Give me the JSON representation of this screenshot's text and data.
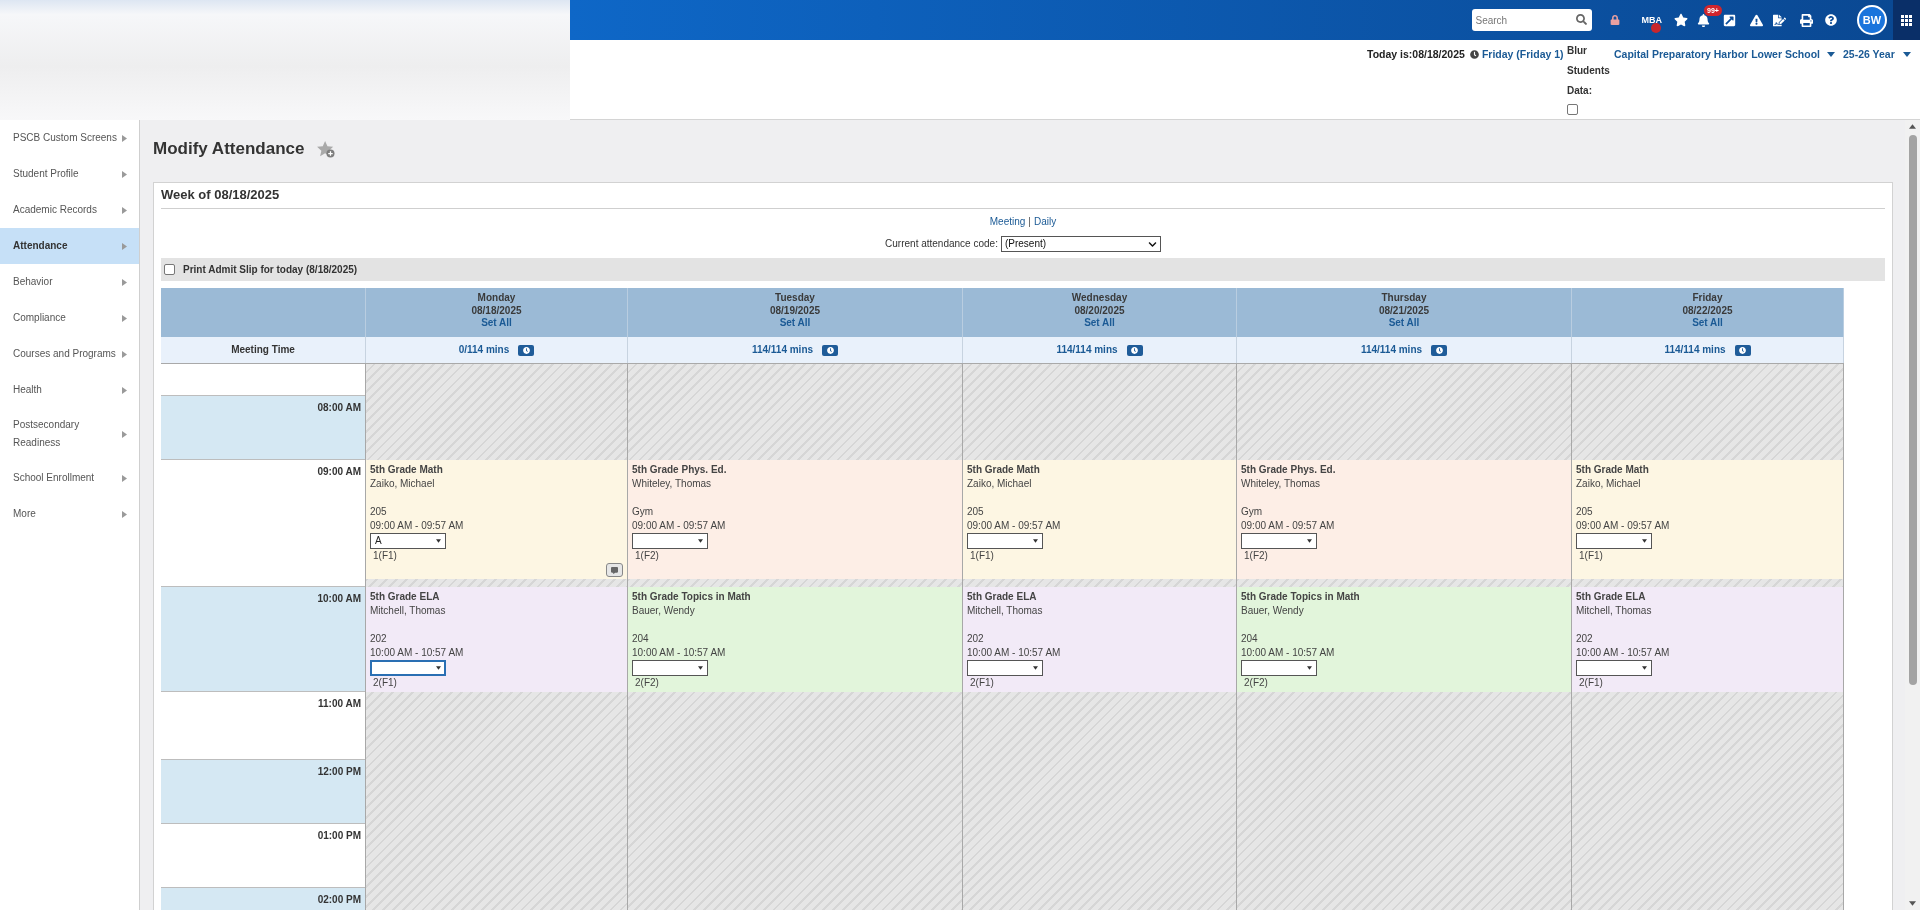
{
  "top_bar": {
    "search": {
      "placeholder": "Search"
    },
    "mba_label": "MBA",
    "notification_count": "99+",
    "avatar_initials": "BW"
  },
  "header": {
    "today": "Today is:08/18/2025",
    "day_link": "Friday (Friday 1)",
    "blur_label": "Blur Students Data:",
    "blur_checked": false,
    "school": "Capital Preparatory Harbor Lower School",
    "year": "25-26 Year"
  },
  "sidebar": {
    "items": [
      {
        "label": "PSCB Custom Screens",
        "selected": false
      },
      {
        "label": "Student Profile",
        "selected": false
      },
      {
        "label": "Academic Records",
        "selected": false
      },
      {
        "label": "Attendance",
        "selected": true
      },
      {
        "label": "Behavior",
        "selected": false
      },
      {
        "label": "Compliance",
        "selected": false
      },
      {
        "label": "Courses and Programs",
        "selected": false
      },
      {
        "label": "Health",
        "selected": false
      },
      {
        "label": "Postsecondary Readiness",
        "selected": false
      },
      {
        "label": "School Enrollment",
        "selected": false
      },
      {
        "label": "More",
        "selected": false
      }
    ]
  },
  "page": {
    "title": "Modify Attendance"
  },
  "week": {
    "title": "Week of 08/18/2025",
    "view_links": [
      "Meeting",
      "Daily"
    ],
    "view_separator": "|",
    "code_label": "Current attendance code:",
    "code_value": "(Present)",
    "admit_slip": {
      "label": "Print Admit Slip for today (8/18/2025)",
      "checked": false
    }
  },
  "calendar": {
    "corner_label": "Meeting Time",
    "times": [
      "08:00 AM",
      "09:00 AM",
      "10:00 AM",
      "11:00 AM",
      "12:00 PM",
      "01:00 PM",
      "02:00 PM"
    ],
    "days": [
      {
        "name": "Monday",
        "date": "08/18/2025",
        "set_all": "Set All",
        "minutes": "0/114 mins",
        "classes": [
          {
            "title": "5th Grade Math",
            "teacher": "Zaiko, Michael",
            "room": "205",
            "time": "09:00 AM - 09:57 AM",
            "code": "A",
            "focused": false,
            "period": "1(F1)",
            "color": "#fdf6e3",
            "comment_button": true
          },
          {
            "title": "5th Grade ELA",
            "teacher": "Mitchell, Thomas",
            "room": "202",
            "time": "10:00 AM - 10:57 AM",
            "focused": true,
            "period": "2(F1)",
            "color": "#f2eaf7",
            "comment_button": false
          }
        ]
      },
      {
        "name": "Tuesday",
        "date": "08/19/2025",
        "set_all": "Set All",
        "minutes": "114/114 mins",
        "classes": [
          {
            "title": "5th Grade Phys. Ed.",
            "teacher": "Whiteley, Thomas",
            "room": "Gym",
            "time": "09:00 AM - 09:57 AM",
            "focused": false,
            "period": "1(F2)",
            "color": "#fdeee6",
            "comment_button": false
          },
          {
            "title": "5th Grade Topics in Math",
            "teacher": "Bauer, Wendy",
            "room": "204",
            "time": "10:00 AM - 10:57 AM",
            "focused": false,
            "period": "2(F2)",
            "color": "#e2f5db",
            "comment_button": false
          }
        ]
      },
      {
        "name": "Wednesday",
        "date": "08/20/2025",
        "set_all": "Set All",
        "minutes": "114/114 mins",
        "classes": [
          {
            "title": "5th Grade Math",
            "teacher": "Zaiko, Michael",
            "room": "205",
            "time": "09:00 AM - 09:57 AM",
            "focused": false,
            "period": "1(F1)",
            "color": "#fdf6e3",
            "comment_button": false
          },
          {
            "title": "5th Grade ELA",
            "teacher": "Mitchell, Thomas",
            "room": "202",
            "time": "10:00 AM - 10:57 AM",
            "focused": false,
            "period": "2(F1)",
            "color": "#f2eaf7",
            "comment_button": false
          }
        ]
      },
      {
        "name": "Thursday",
        "date": "08/21/2025",
        "set_all": "Set All",
        "minutes": "114/114 mins",
        "classes": [
          {
            "title": "5th Grade Phys. Ed.",
            "teacher": "Whiteley, Thomas",
            "room": "Gym",
            "time": "09:00 AM - 09:57 AM",
            "focused": false,
            "period": "1(F2)",
            "color": "#fdeee6",
            "comment_button": false
          },
          {
            "title": "5th Grade Topics in Math",
            "teacher": "Bauer, Wendy",
            "room": "204",
            "time": "10:00 AM - 10:57 AM",
            "focused": false,
            "period": "2(F2)",
            "color": "#e2f5db",
            "comment_button": false
          }
        ]
      },
      {
        "name": "Friday",
        "date": "08/22/2025",
        "set_all": "Set All",
        "minutes": "114/114 mins",
        "classes": [
          {
            "title": "5th Grade Math",
            "teacher": "Zaiko, Michael",
            "room": "205",
            "time": "09:00 AM - 09:57 AM",
            "focused": false,
            "period": "1(F1)",
            "color": "#fdf6e3",
            "comment_button": false
          },
          {
            "title": "5th Grade ELA",
            "teacher": "Mitchell, Thomas",
            "room": "202",
            "time": "10:00 AM - 10:57 AM",
            "focused": false,
            "period": "2(F1)",
            "color": "#f2eaf7",
            "comment_button": false
          }
        ]
      }
    ]
  }
}
